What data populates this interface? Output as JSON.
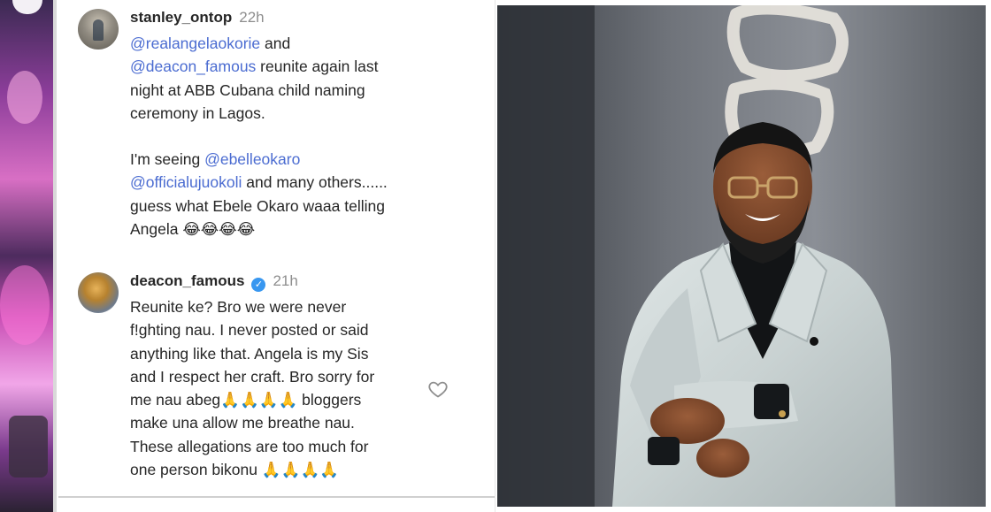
{
  "comments": [
    {
      "username": "stanley_ontop",
      "time": "22h",
      "verified": false,
      "lines": [
        {
          "segments": [
            {
              "text": "@realangelaokorie",
              "mention": true
            },
            {
              "text": " and",
              "mention": false
            }
          ]
        },
        {
          "segments": [
            {
              "text": "@deacon_famous",
              "mention": true
            },
            {
              "text": " reunite again last",
              "mention": false
            }
          ]
        },
        {
          "segments": [
            {
              "text": "night at ABB Cubana child naming",
              "mention": false
            }
          ]
        },
        {
          "segments": [
            {
              "text": "ceremony in Lagos.",
              "mention": false
            }
          ]
        },
        {
          "gap": true
        },
        {
          "segments": [
            {
              "text": "I'm seeing ",
              "mention": false
            },
            {
              "text": "@ebelleokaro",
              "mention": true
            }
          ]
        },
        {
          "segments": [
            {
              "text": "@officialujuokoli",
              "mention": true
            },
            {
              "text": " and many others......",
              "mention": false
            }
          ]
        },
        {
          "segments": [
            {
              "text": "guess what Ebele Okaro waaa telling",
              "mention": false
            }
          ]
        },
        {
          "segments": [
            {
              "text": "Angela 😂😂😂😂",
              "mention": false
            }
          ]
        }
      ]
    },
    {
      "username": "deacon_famous",
      "time": "21h",
      "verified": true,
      "lines": [
        {
          "segments": [
            {
              "text": "Reunite ke? Bro we were never",
              "mention": false
            }
          ]
        },
        {
          "segments": [
            {
              "text": "f!ghting nau. I never posted or said",
              "mention": false
            }
          ]
        },
        {
          "segments": [
            {
              "text": "anything like that. Angela is my Sis",
              "mention": false
            }
          ]
        },
        {
          "segments": [
            {
              "text": "and I respect her craft. Bro sorry for",
              "mention": false
            }
          ]
        },
        {
          "segments": [
            {
              "text": "me nau abeg🙏🙏🙏🙏 bloggers",
              "mention": false
            }
          ]
        },
        {
          "segments": [
            {
              "text": "make una allow me breathe nau.",
              "mention": false
            }
          ]
        },
        {
          "segments": [
            {
              "text": "These allegations are too much for",
              "mention": false
            }
          ]
        },
        {
          "segments": [
            {
              "text": "one person bikonu 🙏🙏🙏🙏",
              "mention": false
            }
          ]
        }
      ]
    }
  ],
  "icons": {
    "verified": "✓",
    "like": "heart-outline-icon",
    "scroll_up": "triangle-up-icon",
    "scroll_down": "triangle-down-icon"
  },
  "colors": {
    "mention": "#4b6cd1",
    "username": "#262626",
    "timestamp": "#8e8e8e",
    "verified_badge": "#3897f0"
  }
}
